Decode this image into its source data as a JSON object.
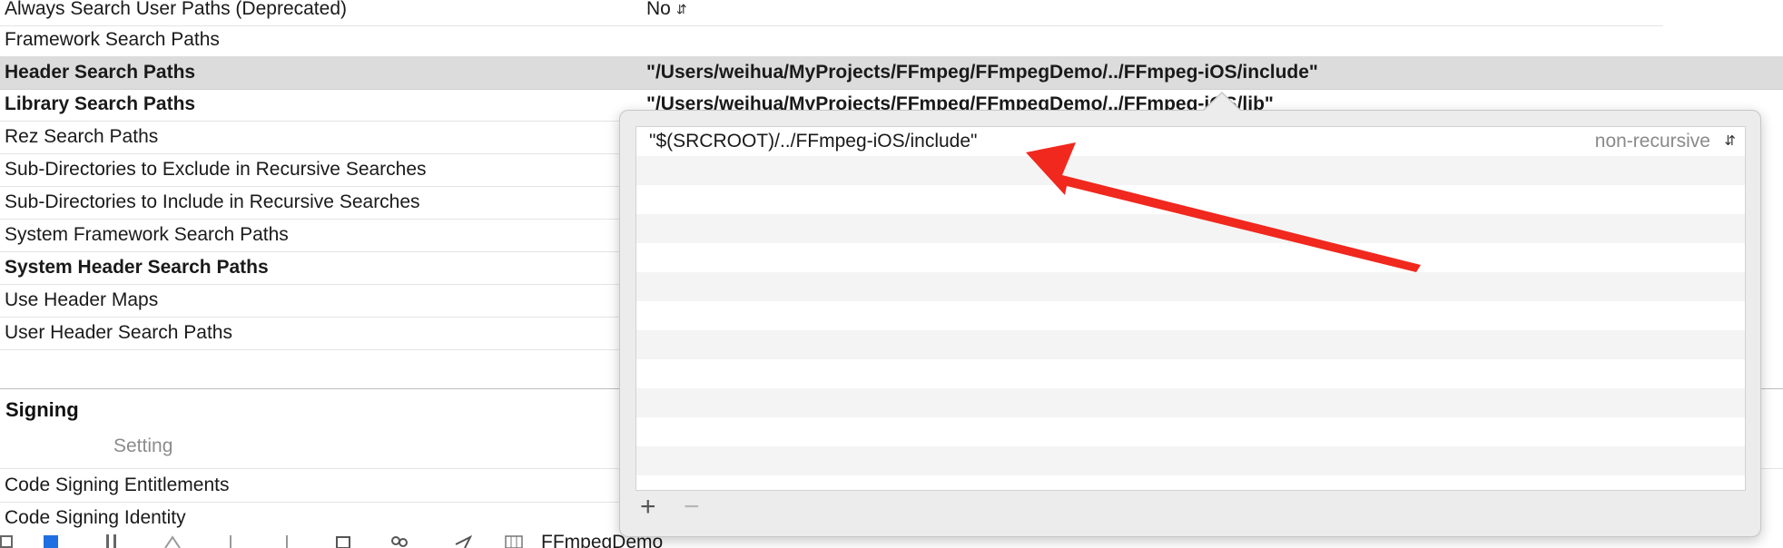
{
  "settings": {
    "rows": [
      {
        "label": "Always Search User Paths (Deprecated)",
        "value": "No"
      },
      {
        "label": "Framework Search Paths",
        "value": ""
      },
      {
        "label": "Header Search Paths",
        "value": "\"/Users/weihua/MyProjects/FFmpeg/FFmpegDemo/../FFmpeg-iOS/include\""
      },
      {
        "label": "Library Search Paths",
        "value": "\"/Users/weihua/MyProjects/FFmpeg/FFmpegDemo/../FFmpeg-iOS/lib\""
      },
      {
        "label": "Rez Search Paths",
        "value": ""
      },
      {
        "label": "Sub-Directories to Exclude in Recursive Searches",
        "value": ""
      },
      {
        "label": "Sub-Directories to Include in Recursive Searches",
        "value": ""
      },
      {
        "label": "System Framework Search Paths",
        "value": ""
      },
      {
        "label": "System Header Search Paths",
        "value": ""
      },
      {
        "label": "Use Header Maps",
        "value": ""
      },
      {
        "label": "User Header Search Paths",
        "value": ""
      }
    ]
  },
  "signing": {
    "title": "Signing",
    "column_header": "Setting",
    "rows": [
      {
        "label": "Code Signing Entitlements"
      },
      {
        "label": "Code Signing Identity"
      }
    ]
  },
  "popover": {
    "entry_path": "\"$(SRCROOT)/../FFmpeg-iOS/include\"",
    "entry_mode": "non-recursive",
    "add_symbol": "+",
    "remove_symbol": "−"
  },
  "annotation": {
    "arrow_color": "#f0281e"
  },
  "toolbar": {
    "project_name": "FFmpegDemo"
  },
  "icons": [
    "up-down-chevron-icon",
    "plus-icon",
    "minus-icon",
    "annotation-arrow-icon",
    "folder-icon",
    "issue-icon",
    "search-icon",
    "warning-icon",
    "test-icon",
    "debug-icon",
    "breakpoint-icon",
    "report-icon"
  ]
}
